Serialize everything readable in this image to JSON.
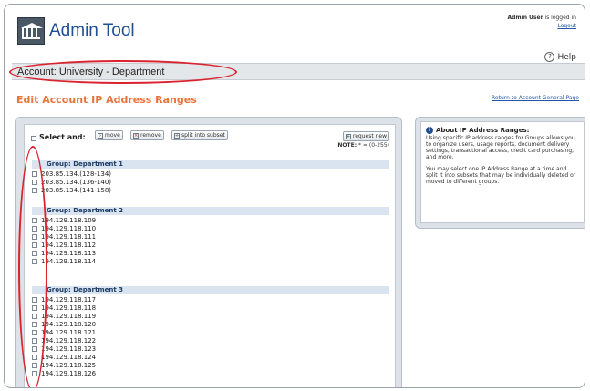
{
  "header": {
    "app_title": "Admin Tool",
    "user_name": "Admin User",
    "logged_in_suffix": " is logged in",
    "logout": "Logout",
    "help": "Help"
  },
  "account": {
    "label": "Account: University - Department"
  },
  "page": {
    "heading": "Edit Account IP Address Ranges",
    "return_link": "Return to Account General Page"
  },
  "toolbar": {
    "select_label": "Select and:",
    "move": "move",
    "remove": "remove",
    "split": "split into subset",
    "request": "request new",
    "note_label": "NOTE:",
    "note_text": " * = (0-255)"
  },
  "groups": [
    {
      "name": "Group: Department 1",
      "ips": [
        "203.85.134.(128-134)",
        "203.85.134.(136-140)",
        "203.85.134.(141-158)"
      ]
    },
    {
      "name": "Group: Department 2",
      "ips": [
        "194.129.118.109",
        "194.129.118.110",
        "194.129.118.111",
        "194.129.118.112",
        "194.129.118.113",
        "194.129.118.114"
      ]
    },
    {
      "name": "Group: Department 3",
      "ips": [
        "194.129.118.117",
        "194.129.118.118",
        "194.129.118.119",
        "194.129.118.120",
        "194.129.118.121",
        "194.129.118.122",
        "194.129.118.123",
        "194.129.118.124",
        "194.129.118.125",
        "194.129.118.126"
      ]
    }
  ],
  "side": {
    "title": "About IP Address Ranges:",
    "p1": "Using specific IP address ranges for Groups allows you to organize users, usage reports, document delivery settings, transactional access, credit card purchasing, and more.",
    "p2": "You may select one IP Address Range at a time and split it into subsets that may be individually deleted or moved to different groups."
  },
  "colors": {
    "heading": "#e8743b",
    "annotation": "#d9232e",
    "title": "#1f4f93"
  }
}
